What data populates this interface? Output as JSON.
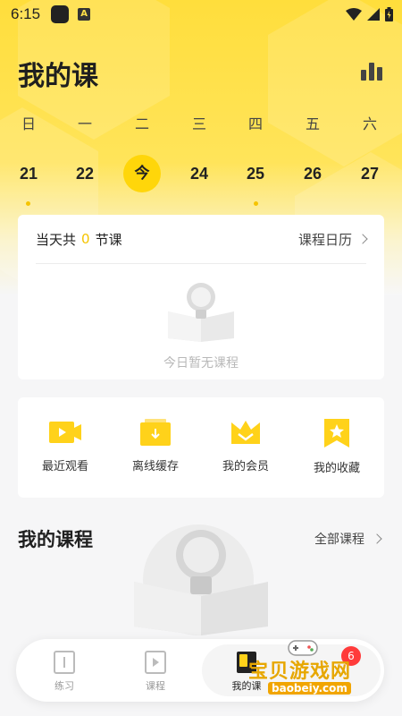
{
  "status": {
    "time": "6:15",
    "notif_letter": "A"
  },
  "header": {
    "title": "我的课"
  },
  "week": {
    "day_names": [
      "日",
      "一",
      "二",
      "三",
      "四",
      "五",
      "六"
    ],
    "dates": [
      "21",
      "22",
      "今",
      "24",
      "25",
      "26",
      "27"
    ]
  },
  "today_card": {
    "prefix": "当天共",
    "count": "0",
    "suffix": "节课",
    "calendar_link": "课程日历",
    "empty_text": "今日暂无课程"
  },
  "actions": [
    {
      "label": "最近观看"
    },
    {
      "label": "离线缓存"
    },
    {
      "label": "我的会员"
    },
    {
      "label": "我的收藏"
    }
  ],
  "my_courses": {
    "title": "我的课程",
    "all_link": "全部课程"
  },
  "nav": [
    {
      "label": "练习"
    },
    {
      "label": "课程"
    },
    {
      "label": "我的课"
    }
  ],
  "watermark": {
    "text": "宝贝游戏网",
    "url": "baobeiy.com",
    "badge": "6"
  },
  "colors": {
    "accent": "#ffd60a",
    "dot": "#f5c400"
  }
}
